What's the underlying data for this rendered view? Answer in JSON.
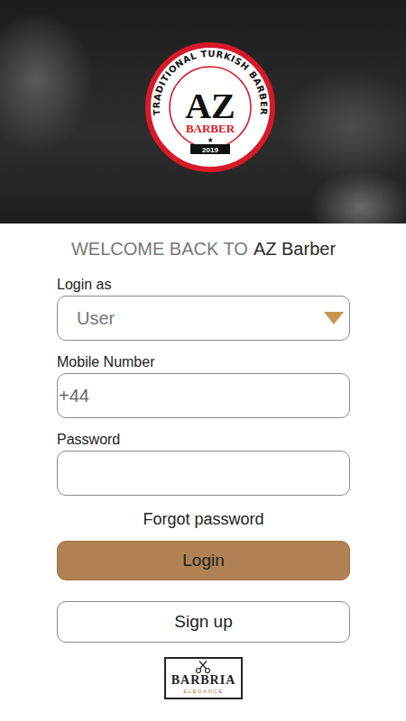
{
  "header": {
    "logo": {
      "ring_text": "TRADITIONAL TURKISH BARBER",
      "monogram": "AZ",
      "banner": "BARBER",
      "star": "★",
      "year": "2019"
    }
  },
  "welcome": {
    "prefix": "WELCOME BACK TO",
    "brand": "AZ Barber"
  },
  "form": {
    "login_as": {
      "label": "Login as",
      "value": "User"
    },
    "mobile": {
      "label": "Mobile Number",
      "value": "+44"
    },
    "password": {
      "label": "Password"
    }
  },
  "forgot": "Forgot password",
  "buttons": [
    {
      "label": "Login",
      "kind": "primary"
    },
    {
      "label": "Sign up",
      "kind": "outline"
    }
  ],
  "footer_logo": {
    "name": "BARBRIA",
    "tagline": "ELEGANCE"
  }
}
